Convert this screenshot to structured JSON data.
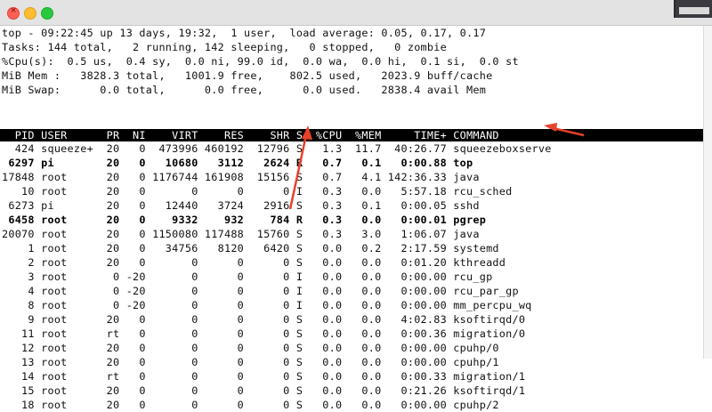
{
  "window": {
    "close_glyph": "×"
  },
  "summary": {
    "line1": "top - 09:22:45 up 13 days, 19:32,  1 user,  load average: 0.05, 0.17, 0.17",
    "line2": "Tasks: 144 total,   2 running, 142 sleeping,   0 stopped,   0 zombie",
    "line3": "%Cpu(s):  0.5 us,  0.4 sy,  0.0 ni, 99.0 id,  0.0 wa,  0.0 hi,  0.1 si,  0.0 st",
    "line4": "MiB Mem :   3828.3 total,   1001.9 free,    802.5 used,   2023.9 buff/cache",
    "line5": "MiB Swap:      0.0 total,      0.0 free,      0.0 used.   2838.4 avail Mem"
  },
  "columns_header": "  PID USER      PR  NI    VIRT    RES    SHR S  %CPU  %MEM     TIME+ COMMAND",
  "processes": [
    {
      "text": "  424 squeeze+  20   0  473996 460192  12796 S   1.3  11.7  40:26.77 squeezeboxserve",
      "bold": false
    },
    {
      "text": " 6297 pi        20   0   10680   3112   2624 R   0.7   0.1   0:00.88 top",
      "bold": true
    },
    {
      "text": "17848 root      20   0 1176744 161908  15156 S   0.7   4.1 142:36.33 java",
      "bold": false
    },
    {
      "text": "   10 root      20   0       0      0      0 I   0.3   0.0   5:57.18 rcu_sched",
      "bold": false
    },
    {
      "text": " 6273 pi        20   0   12440   3724   2916 S   0.3   0.1   0:00.05 sshd",
      "bold": false
    },
    {
      "text": " 6458 root      20   0    9332    932    784 R   0.3   0.0   0:00.01 pgrep",
      "bold": true
    },
    {
      "text": "20070 root      20   0 1150080 117488  15760 S   0.3   3.0   1:06.07 java",
      "bold": false
    },
    {
      "text": "    1 root      20   0   34756   8120   6420 S   0.0   0.2   2:17.59 systemd",
      "bold": false
    },
    {
      "text": "    2 root      20   0       0      0      0 S   0.0   0.0   0:01.20 kthreadd",
      "bold": false
    },
    {
      "text": "    3 root       0 -20       0      0      0 I   0.0   0.0   0:00.00 rcu_gp",
      "bold": false
    },
    {
      "text": "    4 root       0 -20       0      0      0 I   0.0   0.0   0:00.00 rcu_par_gp",
      "bold": false
    },
    {
      "text": "    8 root       0 -20       0      0      0 I   0.0   0.0   0:00.00 mm_percpu_wq",
      "bold": false
    },
    {
      "text": "    9 root      20   0       0      0      0 S   0.0   0.0   4:02.83 ksoftirqd/0",
      "bold": false
    },
    {
      "text": "   11 root      rt   0       0      0      0 S   0.0   0.0   0:00.36 migration/0",
      "bold": false
    },
    {
      "text": "   12 root      20   0       0      0      0 S   0.0   0.0   0:00.00 cpuhp/0",
      "bold": false
    },
    {
      "text": "   13 root      20   0       0      0      0 S   0.0   0.0   0:00.00 cpuhp/1",
      "bold": false
    },
    {
      "text": "   14 root      rt   0       0      0      0 S   0.0   0.0   0:00.33 migration/1",
      "bold": false
    },
    {
      "text": "   15 root      20   0       0      0      0 S   0.0   0.0   0:21.26 ksoftirqd/1",
      "bold": false
    },
    {
      "text": "   18 root      20   0       0      0      0 S   0.0   0.0   0:00.00 cpuhp/2",
      "bold": false
    }
  ],
  "annotation": {
    "arrow_color": "#e8412c"
  }
}
